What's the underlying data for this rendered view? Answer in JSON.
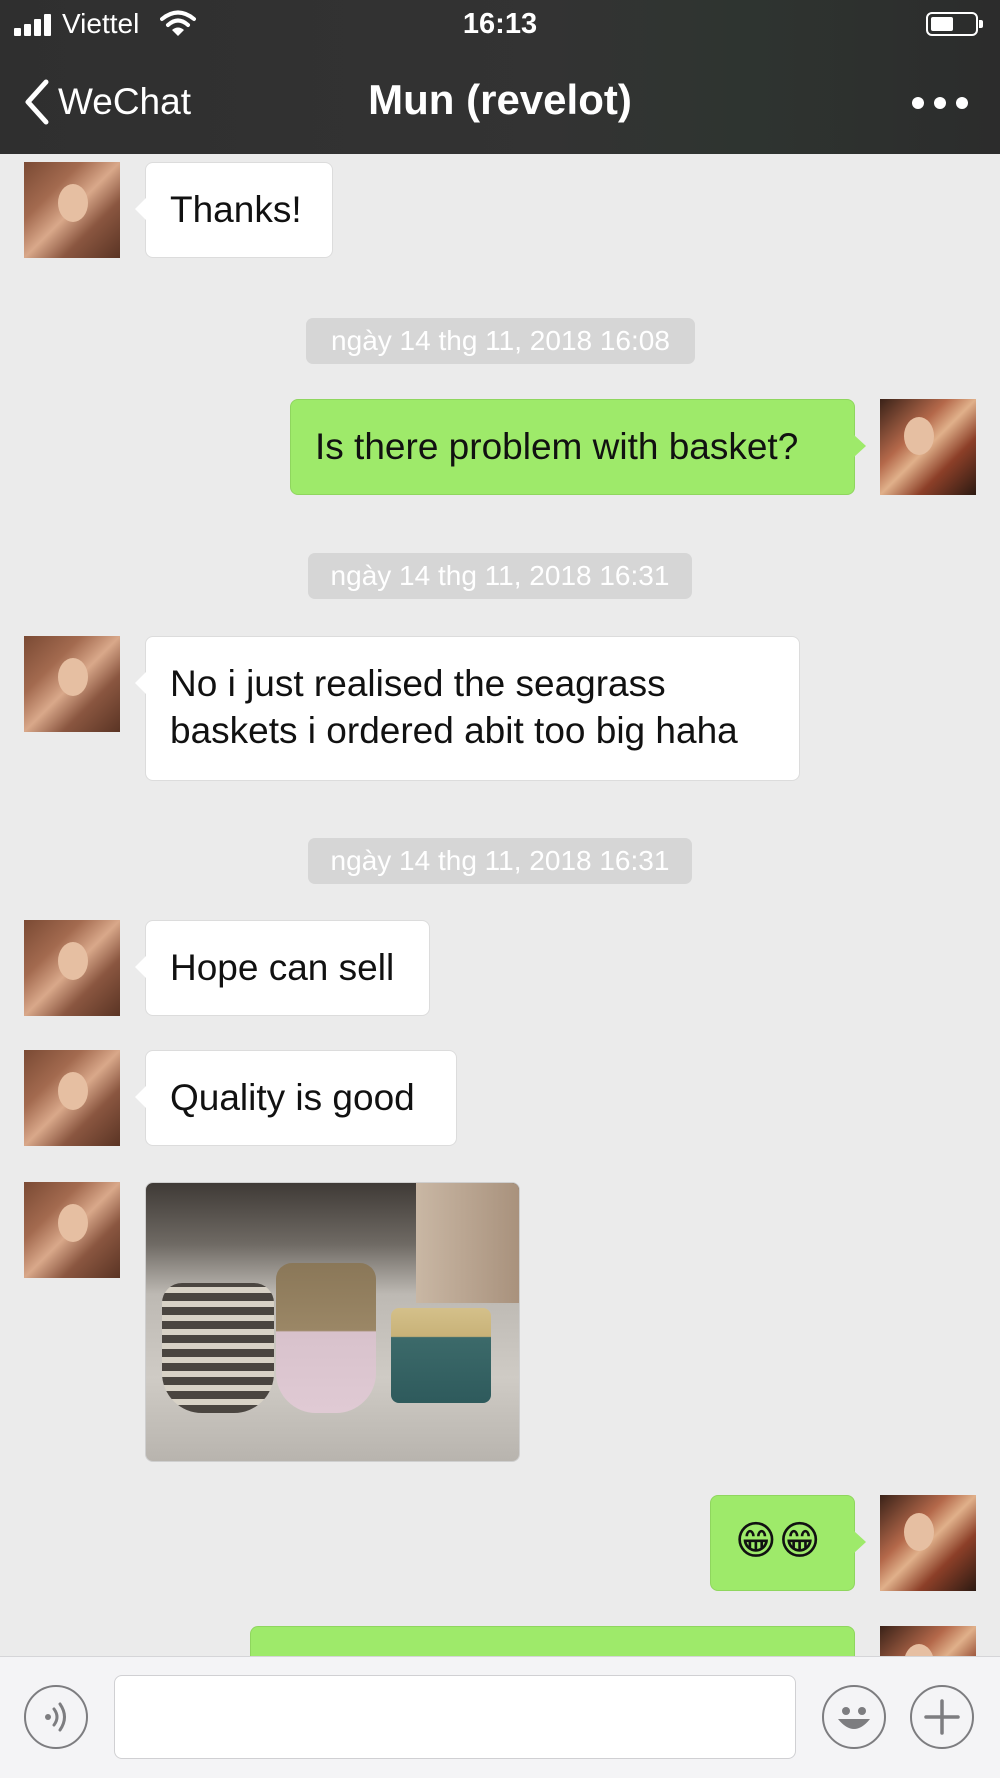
{
  "status_bar": {
    "carrier": "Viettel",
    "time": "16:13",
    "signal_bars": 4,
    "battery_level": 0.45
  },
  "nav": {
    "back_label": "WeChat",
    "title": "Mun (revelot)",
    "more_icon": "ellipsis-icon"
  },
  "messages": [
    {
      "type": "text",
      "from": "contact",
      "text": "Thanks!"
    },
    {
      "type": "timestamp",
      "text": "ngày 14 thg 11, 2018 16:08"
    },
    {
      "type": "text",
      "from": "me",
      "text": "Is there problem with basket?"
    },
    {
      "type": "timestamp",
      "text": "ngày 14 thg 11, 2018 16:31"
    },
    {
      "type": "text",
      "from": "contact",
      "lines": [
        "No i just realised the seagrass",
        "baskets i ordered abit too big haha"
      ]
    },
    {
      "type": "timestamp",
      "text": "ngày 14 thg 11, 2018 16:31"
    },
    {
      "type": "text",
      "from": "contact",
      "text": "Hope can sell"
    },
    {
      "type": "text",
      "from": "contact",
      "text": "Quality is good"
    },
    {
      "type": "image",
      "from": "contact",
      "subject": "seagrass baskets photo"
    },
    {
      "type": "text",
      "from": "me",
      "text": "😁😁"
    },
    {
      "type": "text",
      "from": "me",
      "text": ""
    }
  ],
  "input_bar": {
    "voice_icon": "voice-icon",
    "emoji_icon": "emoji-icon",
    "plus_icon": "plus-icon"
  },
  "colors": {
    "header_bg": "#303030",
    "chat_bg": "#ebebeb",
    "outgoing_bubble": "#9eea6a",
    "incoming_bubble": "#ffffff",
    "timestamp_bg": "#d6d6d6"
  }
}
